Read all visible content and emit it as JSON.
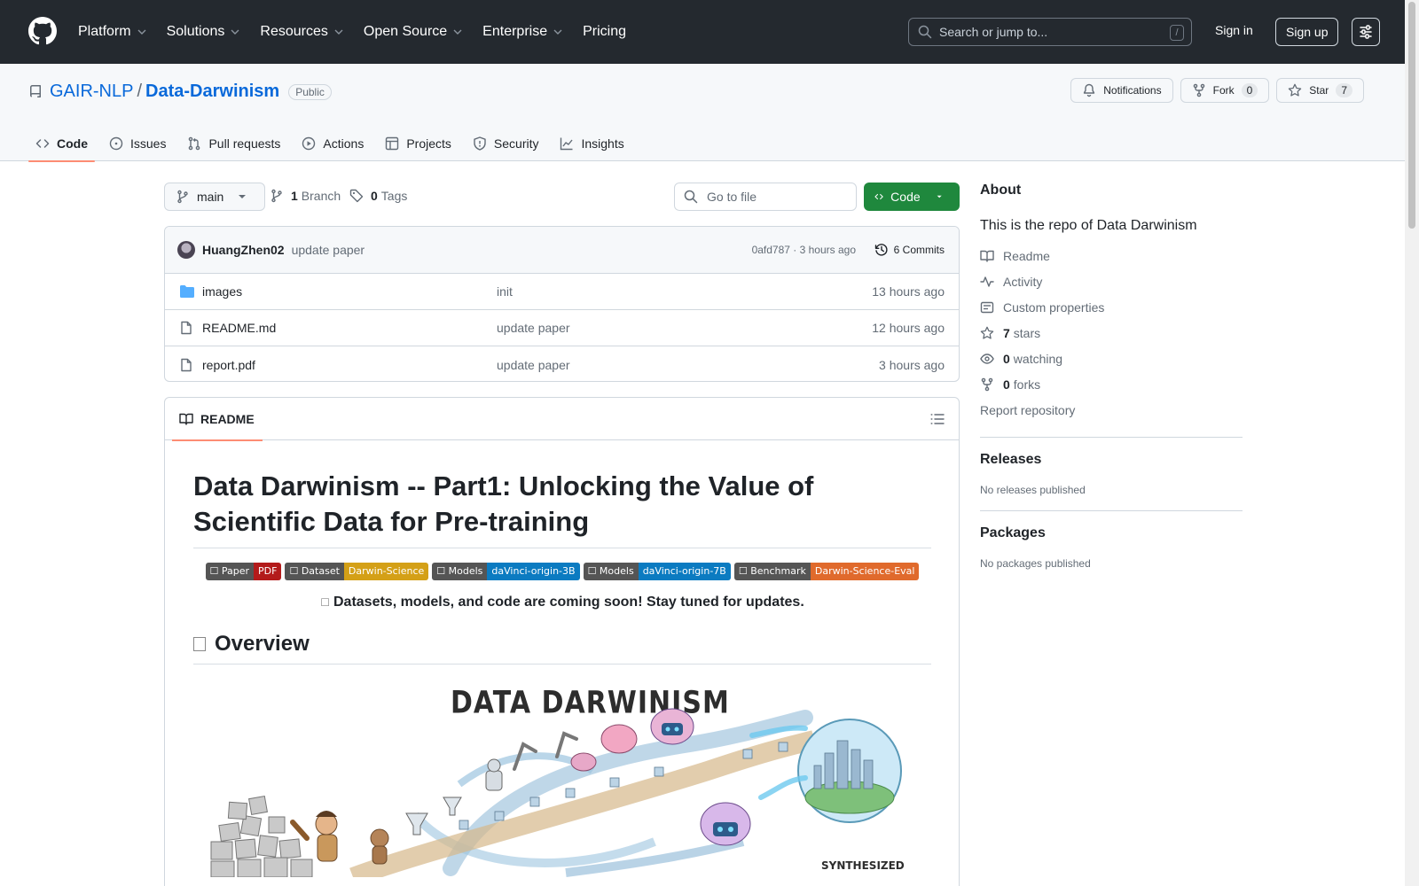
{
  "header": {
    "nav": [
      "Platform",
      "Solutions",
      "Resources",
      "Open Source",
      "Enterprise",
      "Pricing"
    ],
    "nav_has_caret": [
      true,
      true,
      true,
      true,
      true,
      false
    ],
    "search_placeholder": "Search or jump to...",
    "search_shortcut": "/",
    "signin": "Sign in",
    "signup": "Sign up"
  },
  "repo": {
    "owner": "GAIR-NLP",
    "separator": "/",
    "name": "Data-Darwinism",
    "visibility": "Public",
    "notifications_label": "Notifications",
    "fork_label": "Fork",
    "fork_count": "0",
    "star_label": "Star",
    "star_count": "7"
  },
  "tabs": [
    "Code",
    "Issues",
    "Pull requests",
    "Actions",
    "Projects",
    "Security",
    "Insights"
  ],
  "toolbar": {
    "branch": "main",
    "branch_count": "1",
    "branch_label": "Branch",
    "tag_count": "0",
    "tag_label": "Tags",
    "goto_placeholder": "Go to file",
    "code_label": "Code"
  },
  "commit": {
    "author": "HuangZhen02",
    "message": "update paper",
    "hash_time": "0afd787 · 3 hours ago",
    "commits": "6 Commits"
  },
  "files": [
    {
      "type": "folder",
      "name": "images",
      "message": "init",
      "time": "13 hours ago"
    },
    {
      "type": "file",
      "name": "README.md",
      "message": "update paper",
      "time": "12 hours ago"
    },
    {
      "type": "file",
      "name": "report.pdf",
      "message": "update paper",
      "time": "3 hours ago"
    }
  ],
  "readme": {
    "tab_label": "README",
    "title": "Data Darwinism -- Part1: Unlocking the Value of Scientific Data for Pre-training",
    "badges": [
      {
        "left": "☐ Paper",
        "right": "PDF",
        "color": "#b31b1b"
      },
      {
        "left": "☐ Dataset",
        "right": "Darwin-Science",
        "color": "#d4a017"
      },
      {
        "left": "☐ Models",
        "right": "daVinci-origin-3B",
        "color": "#0b7bc1"
      },
      {
        "left": "☐ Models",
        "right": "daVinci-origin-7B",
        "color": "#0b7bc1"
      },
      {
        "left": "☐ Benchmark",
        "right": "Darwin-Science-Eval",
        "color": "#e06a2c"
      }
    ],
    "notice_icon": "☐",
    "notice": "Datasets, models, and code are coming soon! Stay tuned for updates.",
    "overview": "Overview",
    "hero_title": "DATA DARWINISM",
    "hero_caption": "SYNTHESIZED"
  },
  "about": {
    "title": "About",
    "description": "This is the repo of Data Darwinism",
    "readme": "Readme",
    "activity": "Activity",
    "custom_properties": "Custom properties",
    "stars_count": "7",
    "stars_label": "stars",
    "watching_count": "0",
    "watching_label": "watching",
    "forks_count": "0",
    "forks_label": "forks",
    "report": "Report repository"
  },
  "releases": {
    "title": "Releases",
    "empty": "No releases published"
  },
  "packages": {
    "title": "Packages",
    "empty": "No packages published"
  },
  "colors": {
    "header_bg": "#24292f",
    "link": "#0969da",
    "primary": "#1f883d",
    "tab_underline": "#fd8c73"
  }
}
